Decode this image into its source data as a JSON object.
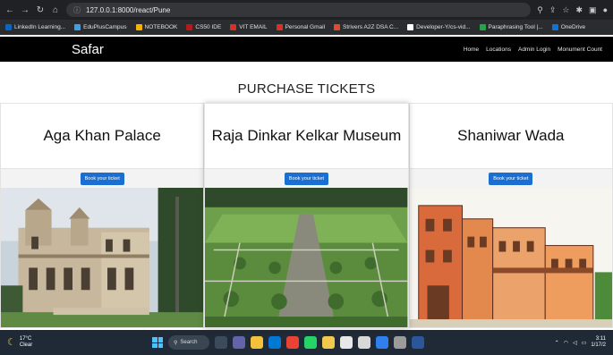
{
  "browser": {
    "url": "127.0.0.1:8000/react/Pune",
    "bookmarks": [
      {
        "label": "LinkedIn Learning...",
        "color": "#0a66c2"
      },
      {
        "label": "EduPlusCampus",
        "color": "#3aa0e8"
      },
      {
        "label": "NOTEBOOK",
        "color": "#f2b400"
      },
      {
        "label": "CS50 IDE",
        "color": "#b31b1b"
      },
      {
        "label": "VIT EMAIL",
        "color": "#d93025"
      },
      {
        "label": "Personal Gmail",
        "color": "#d93025"
      },
      {
        "label": "Strivers A2Z DSA C...",
        "color": "#e04a2a"
      },
      {
        "label": "Developer-Y/cs-vid...",
        "color": "#ffffff"
      },
      {
        "label": "Paraphrasing Tool |...",
        "color": "#2aa14b"
      },
      {
        "label": "OneDrive",
        "color": "#0a74da"
      }
    ]
  },
  "navbar": {
    "brand": "Safar",
    "links": [
      "Home",
      "Locations",
      "Admin Login",
      "Monument Count"
    ]
  },
  "page": {
    "title": "PURCHASE TICKETS",
    "cards": [
      {
        "name": "Aga Khan Palace",
        "button": "Book your ticket"
      },
      {
        "name": "Raja Dinkar Kelkar Museum",
        "button": "Book your ticket"
      },
      {
        "name": "Shaniwar Wada",
        "button": "Book your ticket"
      }
    ]
  },
  "taskbar": {
    "temperature": "17°C",
    "condition": "Clear",
    "search_label": "Search",
    "time": "3:11",
    "date": "1/17/2"
  }
}
